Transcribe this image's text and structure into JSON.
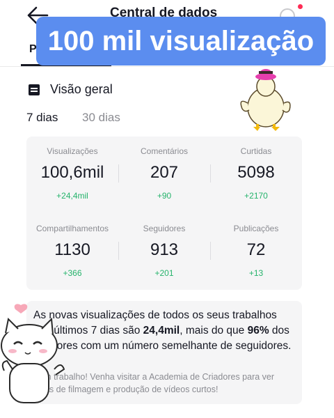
{
  "header": {
    "title": "Central de dados",
    "tab_partial": "P"
  },
  "banner": {
    "text": "100 mil visualização"
  },
  "overview": {
    "title": "Visão geral",
    "periods": [
      "7 dias",
      "30 dias"
    ],
    "selected_period": "7 dias"
  },
  "stats": [
    {
      "label": "Visualizações",
      "value": "100,6mil",
      "delta": "+24,4mil"
    },
    {
      "label": "Comentários",
      "value": "207",
      "delta": "+90"
    },
    {
      "label": "Curtidas",
      "value": "5098",
      "delta": "+2170"
    },
    {
      "label": "Compartilhamentos",
      "value": "1130",
      "delta": "+366"
    },
    {
      "label": "Seguidores",
      "value": "913",
      "delta": "+201"
    },
    {
      "label": "Publicações",
      "value": "72",
      "delta": "+13"
    }
  ],
  "insight": {
    "text_1": "As novas visualizações de todos os seus trabalhos nos últimos 7 dias são ",
    "highlight_value": "24,4mil",
    "text_2": ", mais do que ",
    "highlight_percent": "96%",
    "text_3": " dos criadores com um número semelhante de seguidores.",
    "subtext": "Bom trabalho! Venha visitar a Academia de Criadores para ver dicas de filmagem e produção de vídeos curtos!"
  },
  "colors": {
    "banner": "#5b8def",
    "positive": "#25b36b",
    "muted": "#8a8b91",
    "card": "#f5f5f6",
    "notification": "#fe2c55"
  },
  "icons": [
    "back-arrow-icon",
    "help-icon",
    "overview-icon"
  ],
  "stickers": [
    "duck-sticker",
    "cat-sticker"
  ]
}
